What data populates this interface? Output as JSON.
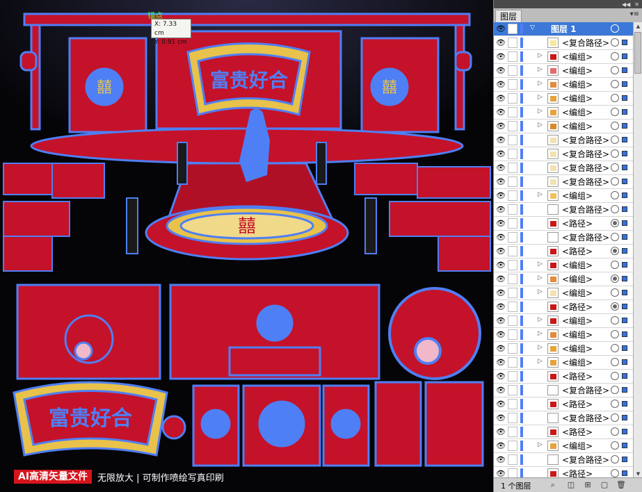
{
  "canvas": {
    "anchor_label": "锚点",
    "tooltip_x": "X: 7.33 cm",
    "tooltip_y": "Y: 0.91 cm",
    "sign_text": "富贵好合",
    "sign_text_bottom": "富贵好合",
    "double_happiness": "囍",
    "promo_badge": "AI高清矢量文件",
    "promo_text": "无限放大 | 可制作喷绘写真印刷"
  },
  "panel": {
    "tab_label": "图层",
    "menu_icon": "panel-menu-icon",
    "top_layer_name": "图层 1",
    "layer_count": "1 个图层",
    "colors": {
      "accent": "#3b78d8",
      "selection": "#4f7ff5"
    },
    "layers": [
      {
        "name": "<复合路径>",
        "expand": false,
        "thumb": "#f7e7a0",
        "filled": false
      },
      {
        "name": "<编组>",
        "expand": true,
        "thumb": "#c81818",
        "filled": false
      },
      {
        "name": "<编组>",
        "expand": true,
        "thumb": "#e56a6a",
        "filled": false
      },
      {
        "name": "<编组>",
        "expand": true,
        "thumb": "#e38a3b",
        "filled": false
      },
      {
        "name": "<编组>",
        "expand": true,
        "thumb": "#e5a43b",
        "filled": false
      },
      {
        "name": "<编组>",
        "expand": true,
        "thumb": "#e5a43b",
        "filled": false
      },
      {
        "name": "<编组>",
        "expand": true,
        "thumb": "#d88a2a",
        "filled": false
      },
      {
        "name": "<复合路径>",
        "expand": false,
        "thumb": "#f2e2b0",
        "filled": false
      },
      {
        "name": "<复合路径>",
        "expand": false,
        "thumb": "#f2e2b0",
        "filled": false
      },
      {
        "name": "<复合路径>",
        "expand": false,
        "thumb": "#f2e2b0",
        "filled": false
      },
      {
        "name": "<复合路径>",
        "expand": false,
        "thumb": "#f2e2b0",
        "filled": false
      },
      {
        "name": "<编组>",
        "expand": true,
        "thumb": "#f0c060",
        "filled": false
      },
      {
        "name": "<复合路径>",
        "expand": false,
        "thumb": "#ffffff",
        "filled": false
      },
      {
        "name": "<路径>",
        "expand": false,
        "thumb": "#c81818",
        "filled": true
      },
      {
        "name": "<复合路径>",
        "expand": false,
        "thumb": "#ffffff",
        "filled": false
      },
      {
        "name": "<路径>",
        "expand": false,
        "thumb": "#c81818",
        "filled": true
      },
      {
        "name": "<编组>",
        "expand": true,
        "thumb": "#c81818",
        "filled": false
      },
      {
        "name": "<编组>",
        "expand": true,
        "thumb": "#e38a3b",
        "filled": true
      },
      {
        "name": "<编组>",
        "expand": true,
        "thumb": "#f2e2b0",
        "filled": false
      },
      {
        "name": "<路径>",
        "expand": false,
        "thumb": "#c81818",
        "filled": true
      },
      {
        "name": "<编组>",
        "expand": true,
        "thumb": "#c81818",
        "filled": false
      },
      {
        "name": "<编组>",
        "expand": true,
        "thumb": "#e38a3b",
        "filled": false
      },
      {
        "name": "<编组>",
        "expand": true,
        "thumb": "#e5a43b",
        "filled": false
      },
      {
        "name": "<编组>",
        "expand": true,
        "thumb": "#e5a43b",
        "filled": false
      },
      {
        "name": "<路径>",
        "expand": false,
        "thumb": "#c81818",
        "filled": false
      },
      {
        "name": "<复合路径>",
        "expand": false,
        "thumb": "#ffffff",
        "filled": false
      },
      {
        "name": "<路径>",
        "expand": false,
        "thumb": "#c81818",
        "filled": false
      },
      {
        "name": "<复合路径>",
        "expand": false,
        "thumb": "#ffffff",
        "filled": false
      },
      {
        "name": "<路径>",
        "expand": false,
        "thumb": "#c81818",
        "filled": false
      },
      {
        "name": "<编组>",
        "expand": true,
        "thumb": "#e5a43b",
        "filled": false
      },
      {
        "name": "<复合路径>",
        "expand": false,
        "thumb": "#ffffff",
        "filled": false
      },
      {
        "name": "<路径>",
        "expand": false,
        "thumb": "#c81818",
        "filled": false
      }
    ]
  }
}
